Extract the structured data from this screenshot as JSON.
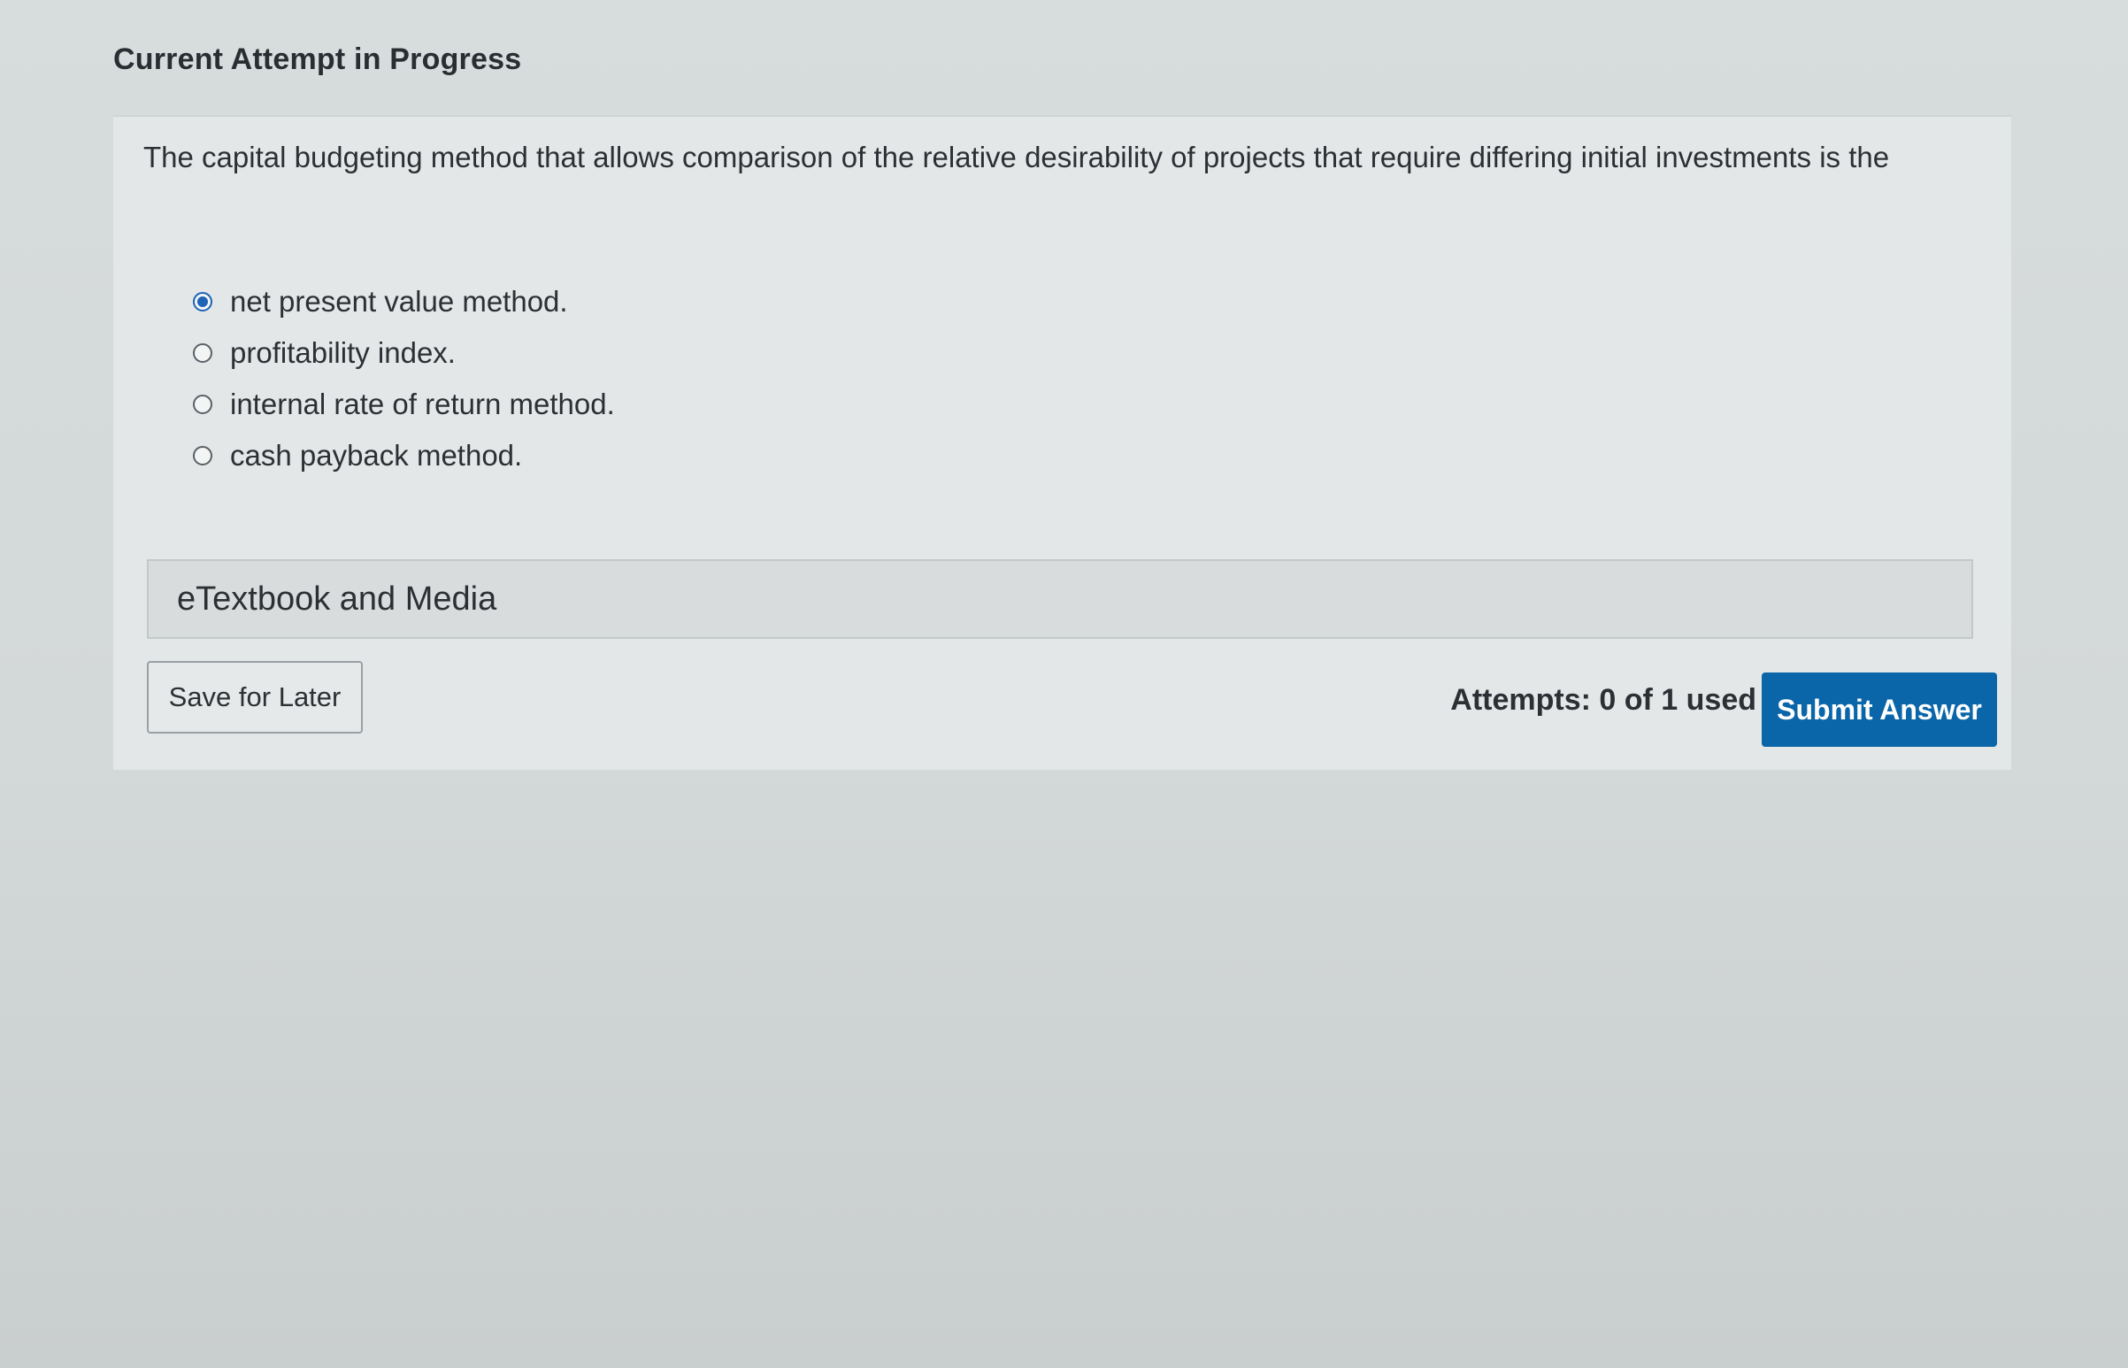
{
  "header": {
    "title": "Current Attempt in Progress"
  },
  "question": {
    "text": "The capital budgeting method that allows comparison of the relative desirability of projects that require differing initial investments is the"
  },
  "options": [
    {
      "label": "net present value method.",
      "selected": true
    },
    {
      "label": "profitability index.",
      "selected": false
    },
    {
      "label": "internal rate of return method.",
      "selected": false
    },
    {
      "label": "cash payback method.",
      "selected": false
    }
  ],
  "etextbook": {
    "label": "eTextbook and Media"
  },
  "footer": {
    "save_label": "Save for Later",
    "attempts_text": "Attempts: 0 of 1 used",
    "submit_label": "Submit Answer"
  },
  "colors": {
    "accent": "#0a66a8",
    "radio_selected": "#1e63b5"
  }
}
